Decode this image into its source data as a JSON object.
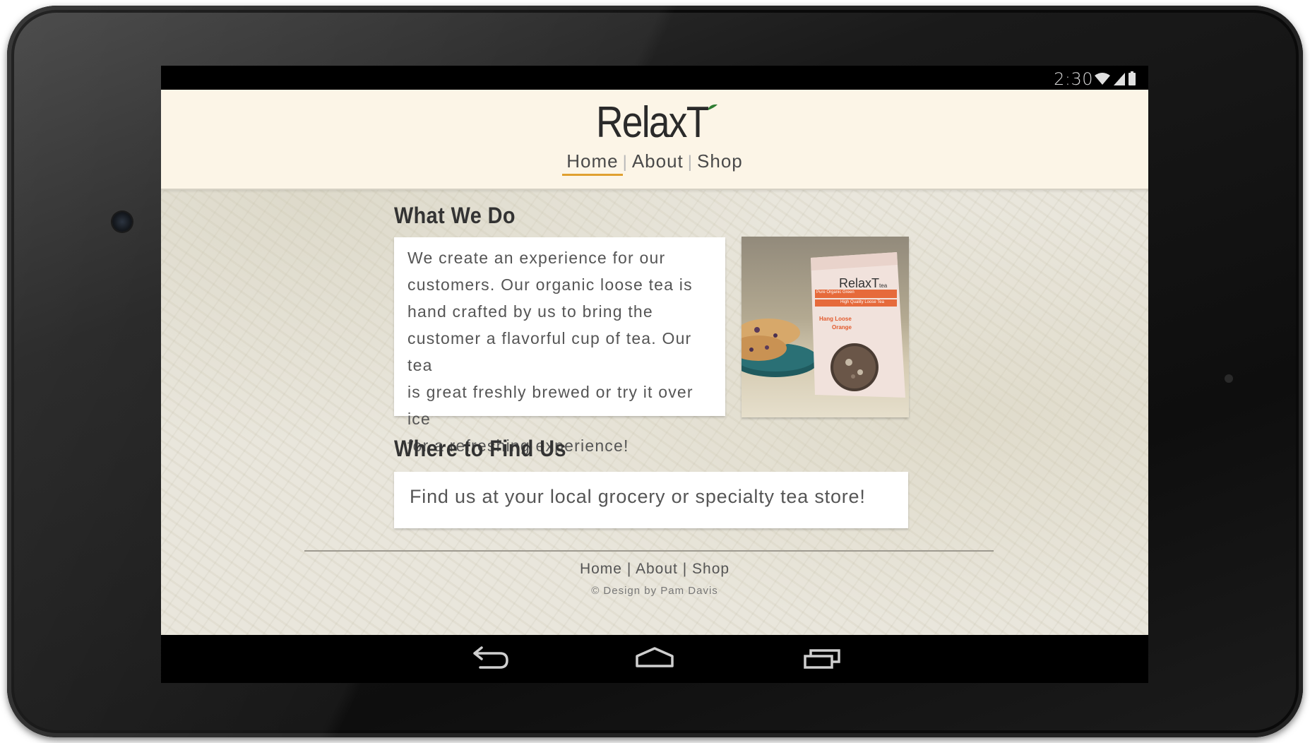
{
  "status_bar": {
    "time": "2:30",
    "icons": [
      "wifi-icon",
      "signal-icon",
      "battery-icon"
    ]
  },
  "brand": {
    "logo_text": "RelaxT",
    "leaf_color": "#2e7d32"
  },
  "nav": {
    "items": [
      {
        "label": "Home",
        "active": true
      },
      {
        "label": "About",
        "active": false
      },
      {
        "label": "Shop",
        "active": false
      }
    ],
    "separator": "|",
    "active_color": "#e0a030"
  },
  "sections": {
    "what_we_do": {
      "heading": "What We Do",
      "lines": [
        "We create an experience for our",
        "customers. Our organic loose tea is",
        "hand crafted by us to bring the",
        "customer a flavorful cup of tea. Our tea",
        "is great freshly brewed or try it over ice",
        "for a refreshing experience!"
      ],
      "photo": {
        "package_brand": "RelaxT",
        "package_brand_suffix": "tea",
        "package_line1": "Pure Organic Green",
        "package_line2": "High Quality Loose Tea",
        "flavor_line1": "Hang Loose",
        "flavor_line2": "Orange"
      }
    },
    "where_to_find": {
      "heading": "Where to Find Us",
      "text": "Find us at your local grocery or specialty tea store!"
    }
  },
  "footer": {
    "links": [
      "Home",
      "About",
      "Shop"
    ],
    "separator": "|",
    "copyright": "© Design by Pam Davis"
  },
  "system_nav": {
    "buttons": [
      "back-icon",
      "home-icon",
      "recents-icon"
    ]
  }
}
